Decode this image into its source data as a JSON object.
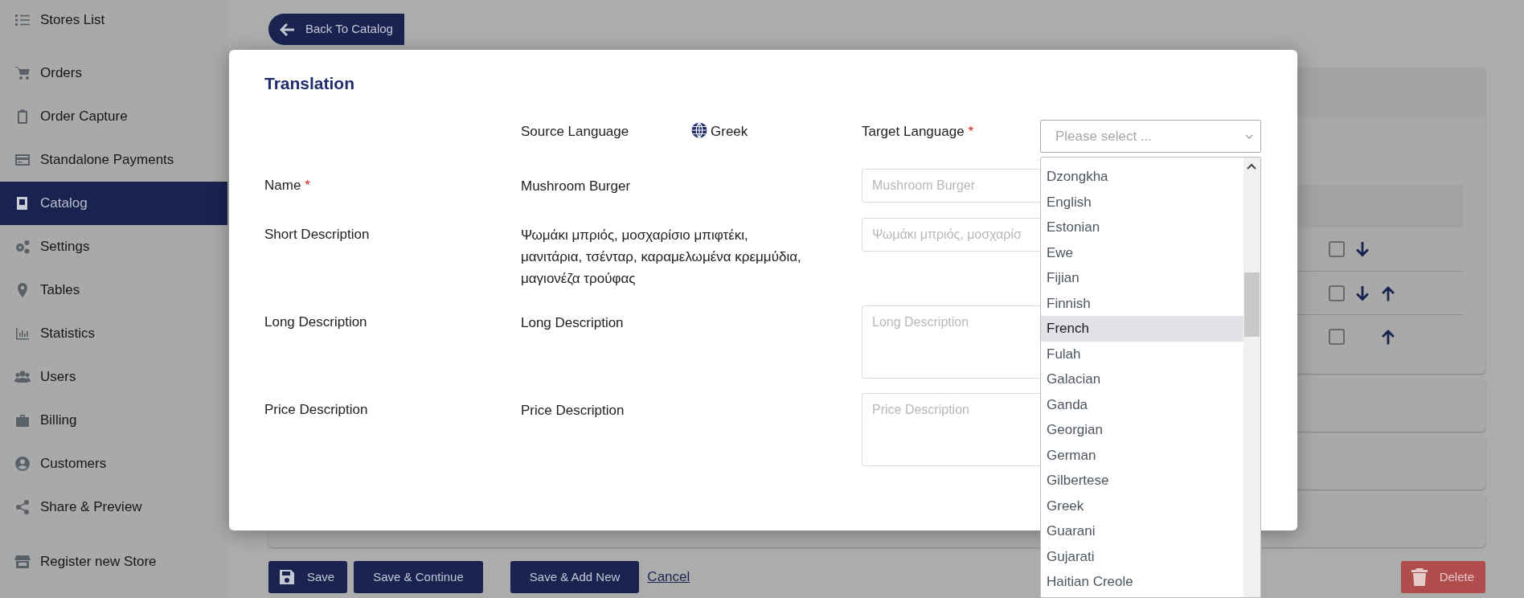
{
  "sidebar": {
    "groups": [
      {
        "items": [
          {
            "label": "Stores List",
            "selected": false
          }
        ]
      },
      {
        "items": [
          {
            "label": "Orders",
            "selected": false
          },
          {
            "label": "Order Capture",
            "selected": false
          },
          {
            "label": "Standalone Payments",
            "selected": false
          },
          {
            "label": "Catalog",
            "selected": true
          },
          {
            "label": "Settings",
            "selected": false
          },
          {
            "label": "Tables",
            "selected": false
          },
          {
            "label": "Statistics",
            "selected": false
          },
          {
            "label": "Users",
            "selected": false
          },
          {
            "label": "Billing",
            "selected": false
          },
          {
            "label": "Customers",
            "selected": false
          },
          {
            "label": "Share & Preview",
            "selected": false
          }
        ]
      },
      {
        "items": [
          {
            "label": "Register new Store",
            "selected": false
          }
        ]
      }
    ]
  },
  "page": {
    "back_button": "Back To Catalog",
    "rows": [
      {
        "checked": false,
        "move_down": true,
        "move_up": false
      },
      {
        "checked": false,
        "move_down": true,
        "move_up": true
      },
      {
        "checked": false,
        "move_down": false,
        "move_up": true
      }
    ],
    "actions": [
      {
        "label": "Save",
        "kind": "icon-button"
      },
      {
        "label": "Save & Continue",
        "kind": "button"
      },
      {
        "label": "Save & Add New",
        "kind": "button"
      },
      {
        "label": "Cancel",
        "kind": "link"
      }
    ],
    "delete_button": "Delete"
  },
  "modal": {
    "title": "Translation",
    "source_label": "Source Language",
    "source_value": "Greek",
    "target_label": "Target Language",
    "target_required_mark": "*",
    "target_placeholder": "Please select ...",
    "fields": [
      {
        "label": "Name",
        "required_mark": "*",
        "source": "Mushroom Burger",
        "placeholder": "Mushroom Burger",
        "kind": "input"
      },
      {
        "label": "Short Description",
        "source": "Ψωμάκι μπριός, μοσχαρίσιο μπιφτέκι, μανιτάρια, τσένταρ, καραμελωμένα κρεμμύδια, μαγιονέζα τρούφας",
        "placeholder": "Ψωμάκι μπριός, μοσχαρίσ",
        "kind": "input"
      },
      {
        "label": "Long Description",
        "source": "Long Description",
        "placeholder": "Long Description",
        "kind": "textarea"
      },
      {
        "label": "Price Description",
        "source": "Price Description",
        "placeholder": "Price Description",
        "kind": "textarea"
      }
    ],
    "dropdown": {
      "options": [
        {
          "label": "Dzongkha",
          "selected": false
        },
        {
          "label": "English",
          "selected": false
        },
        {
          "label": "Estonian",
          "selected": false
        },
        {
          "label": "Ewe",
          "selected": false
        },
        {
          "label": "Fijian",
          "selected": false
        },
        {
          "label": "Finnish",
          "selected": false
        },
        {
          "label": "French",
          "selected": true
        },
        {
          "label": "Fulah",
          "selected": false
        },
        {
          "label": "Galacian",
          "selected": false
        },
        {
          "label": "Ganda",
          "selected": false
        },
        {
          "label": "Georgian",
          "selected": false
        },
        {
          "label": "German",
          "selected": false
        },
        {
          "label": "Gilbertese",
          "selected": false
        },
        {
          "label": "Greek",
          "selected": false
        },
        {
          "label": "Guarani",
          "selected": false
        },
        {
          "label": "Gujarati",
          "selected": false
        },
        {
          "label": "Haitian Creole",
          "selected": false
        }
      ]
    }
  }
}
